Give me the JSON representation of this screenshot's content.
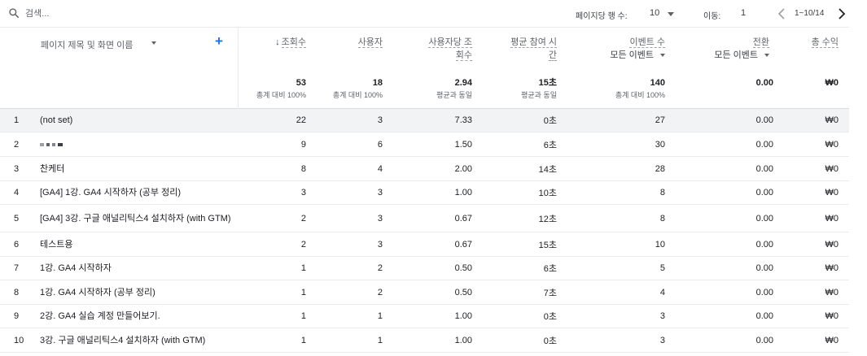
{
  "toolbar": {
    "search_placeholder": "검색...",
    "rows_per_page_label": "페이지당 행 수:",
    "rows_per_page_value": "10",
    "goto_label": "이동:",
    "goto_value": "1",
    "range_text": "1~10/14"
  },
  "header": {
    "dimension_label": "페이지 제목 및 화면 이름",
    "columns": [
      {
        "label": "조회수",
        "sorted": "desc",
        "total": "53",
        "total_sub": "총계 대비 100%"
      },
      {
        "label": "사용자",
        "total": "18",
        "total_sub": "총계 대비 100%"
      },
      {
        "label_line1": "사용자당 조",
        "label_line2": "회수",
        "total": "2.94",
        "total_sub": "평균과 동일"
      },
      {
        "label_line1": "평균 참여 시",
        "label_line2": "간",
        "total": "15초",
        "total_sub": "평균과 동일"
      },
      {
        "label": "이벤트 수",
        "sub": "모든 이벤트",
        "total": "140",
        "total_sub": "총계 대비 100%"
      },
      {
        "label": "전환",
        "sub": "모든 이벤트",
        "total": "0.00"
      },
      {
        "label": "총 수익",
        "total": "₩0"
      }
    ]
  },
  "rows": [
    {
      "idx": "1",
      "name": "(not set)",
      "views": "22",
      "users": "3",
      "vpu": "7.33",
      "eng": "0초",
      "events": "27",
      "conv": "0.00",
      "rev": "₩0"
    },
    {
      "idx": "2",
      "name": "",
      "redacted": true,
      "views": "9",
      "users": "6",
      "vpu": "1.50",
      "eng": "6초",
      "events": "30",
      "conv": "0.00",
      "rev": "₩0"
    },
    {
      "idx": "3",
      "name": "찬케터",
      "views": "8",
      "users": "4",
      "vpu": "2.00",
      "eng": "14초",
      "events": "28",
      "conv": "0.00",
      "rev": "₩0"
    },
    {
      "idx": "4",
      "name": "[GA4] 1강. GA4 시작하자 (공부 정리)",
      "views": "3",
      "users": "3",
      "vpu": "1.00",
      "eng": "10초",
      "events": "8",
      "conv": "0.00",
      "rev": "₩0"
    },
    {
      "idx": "5",
      "name": "[GA4] 3강. 구글 애널리틱스4 설치하자 (with GTM)",
      "views": "2",
      "users": "3",
      "vpu": "0.67",
      "eng": "12초",
      "events": "8",
      "conv": "0.00",
      "rev": "₩0"
    },
    {
      "idx": "6",
      "name": "테스트용",
      "views": "2",
      "users": "3",
      "vpu": "0.67",
      "eng": "15초",
      "events": "10",
      "conv": "0.00",
      "rev": "₩0"
    },
    {
      "idx": "7",
      "name": "1강. GA4 시작하자",
      "views": "1",
      "users": "2",
      "vpu": "0.50",
      "eng": "6초",
      "events": "5",
      "conv": "0.00",
      "rev": "₩0"
    },
    {
      "idx": "8",
      "name": "1강. GA4 시작하자 (공부 정리)",
      "views": "1",
      "users": "2",
      "vpu": "0.50",
      "eng": "7초",
      "events": "4",
      "conv": "0.00",
      "rev": "₩0"
    },
    {
      "idx": "9",
      "name": "2강. GA4 실습 계정 만들어보기.",
      "views": "1",
      "users": "1",
      "vpu": "1.00",
      "eng": "0초",
      "events": "3",
      "conv": "0.00",
      "rev": "₩0"
    },
    {
      "idx": "10",
      "name": "3강. 구글 애널리틱스4 설치하자 (with GTM)",
      "views": "1",
      "users": "1",
      "vpu": "1.00",
      "eng": "0초",
      "events": "3",
      "conv": "0.00",
      "rev": "₩0"
    }
  ]
}
